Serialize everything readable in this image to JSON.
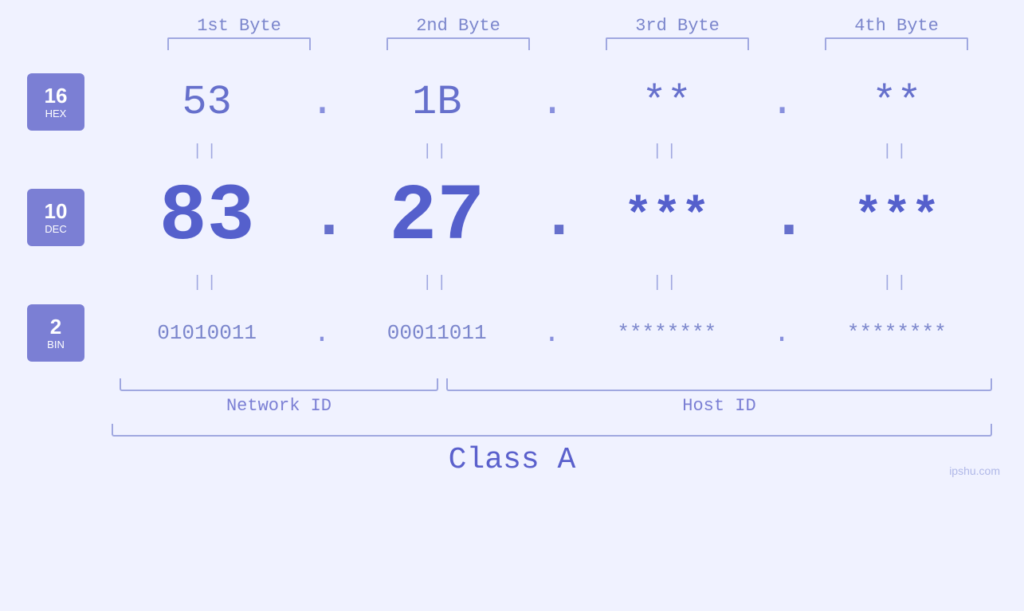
{
  "bytes": {
    "labels": [
      "1st Byte",
      "2nd Byte",
      "3rd Byte",
      "4th Byte"
    ]
  },
  "badges": [
    {
      "number": "16",
      "label": "HEX"
    },
    {
      "number": "10",
      "label": "DEC"
    },
    {
      "number": "2",
      "label": "BIN"
    }
  ],
  "rows": {
    "hex": {
      "values": [
        "53",
        "1B",
        "**",
        "**"
      ],
      "dots": [
        ".",
        ".",
        ".",
        ""
      ]
    },
    "dec": {
      "values": [
        "83",
        "27",
        "***",
        "***"
      ],
      "dots": [
        ".",
        ".",
        ".",
        ""
      ]
    },
    "bin": {
      "values": [
        "01010011",
        "00011011",
        "********",
        "********"
      ],
      "dots": [
        ".",
        ".",
        ".",
        ""
      ]
    }
  },
  "labels": {
    "networkId": "Network ID",
    "hostId": "Host ID",
    "classA": "Class A"
  },
  "watermark": "ipshu.com",
  "equals": "||"
}
